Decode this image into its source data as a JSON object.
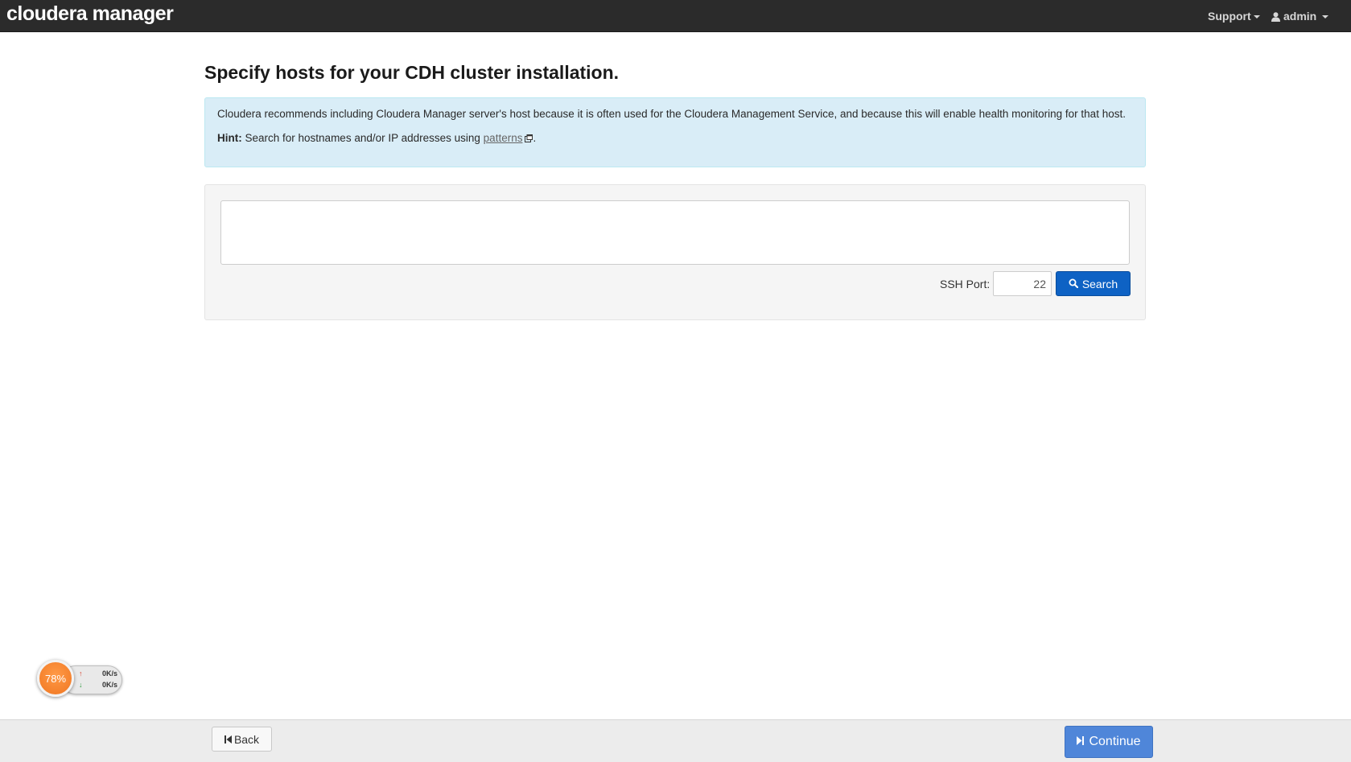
{
  "app": {
    "brand": "cloudera manager"
  },
  "navbar": {
    "support_label": "Support",
    "user_label": "admin"
  },
  "main": {
    "title": "Specify hosts for your CDH cluster installation.",
    "alert": {
      "text": "Cloudera recommends including Cloudera Manager server's host because it is often used for the Cloudera Management Service, and because this will enable health monitoring for that host.",
      "hint_label": "Hint:",
      "hint_text": " Search for hostnames and/or IP addresses using ",
      "hint_link": "patterns",
      "hint_end": "."
    },
    "hosts_input": {
      "value": "",
      "placeholder": ""
    },
    "ssh_port": {
      "label": "SSH Port:",
      "value": "22"
    },
    "search_button": "Search"
  },
  "footer": {
    "back_label": "Back",
    "continue_label": "Continue"
  },
  "speed_widget": {
    "percent": "78%",
    "upload": "0K/s",
    "download": "0K/s"
  },
  "colors": {
    "navbar_bg": "#2b2b2b",
    "alert_bg": "#d9edf7",
    "search_button": "#0e62c4",
    "continue_button": "#4f86d9",
    "widget_orange": "#f07621"
  }
}
